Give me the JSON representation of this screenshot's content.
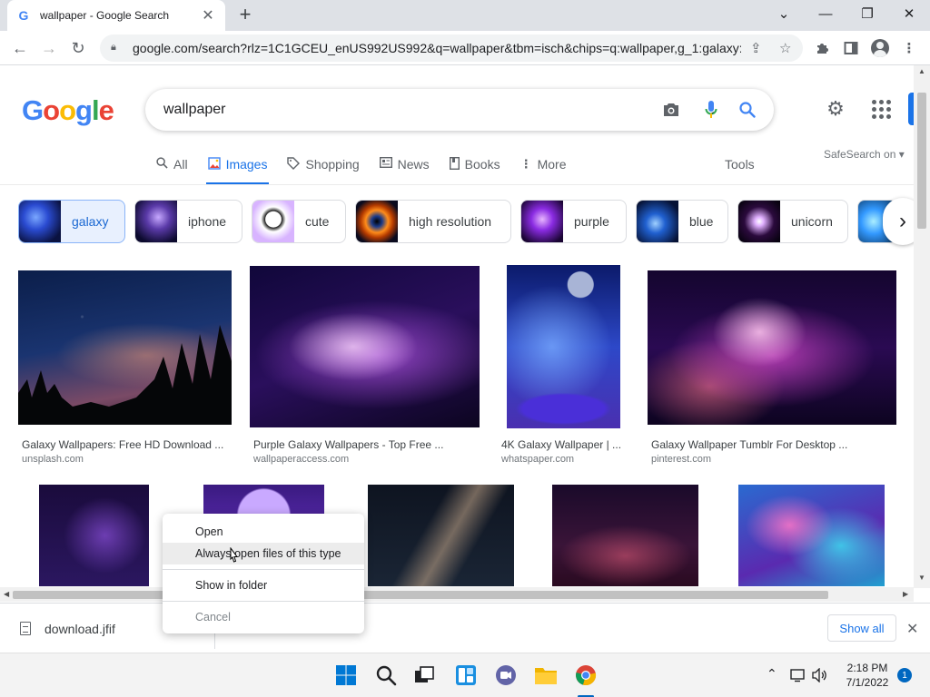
{
  "browser": {
    "tab_title": "wallpaper - Google Search",
    "url": "google.com/search?rlz=1C1GCEU_enUS992US992&q=wallpaper&tbm=isch&chips=q:wallpaper,g_1:galaxy:..."
  },
  "google": {
    "logo": "Google",
    "query": "wallpaper",
    "tabs": [
      {
        "label": "All",
        "icon": "search-icon"
      },
      {
        "label": "Images",
        "icon": "images-icon",
        "active": true
      },
      {
        "label": "Shopping",
        "icon": "tag-icon"
      },
      {
        "label": "News",
        "icon": "news-icon"
      },
      {
        "label": "Books",
        "icon": "book-icon"
      },
      {
        "label": "More",
        "icon": "more-vert-icon"
      }
    ],
    "tools_label": "Tools",
    "safesearch_label": "SafeSearch on"
  },
  "chips": [
    {
      "label": "galaxy",
      "selected": true
    },
    {
      "label": "iphone"
    },
    {
      "label": "cute"
    },
    {
      "label": "high resolution"
    },
    {
      "label": "purple"
    },
    {
      "label": "blue"
    },
    {
      "label": "unicorn"
    }
  ],
  "results": [
    {
      "title": "Galaxy Wallpapers: Free HD Download ...",
      "source": "unsplash.com"
    },
    {
      "title": "Purple Galaxy Wallpapers - Top Free ...",
      "source": "wallpaperaccess.com"
    },
    {
      "title": "4K Galaxy Wallpaper | ...",
      "source": "whatspaper.com"
    },
    {
      "title": "Galaxy Wallpaper Tumblr For Desktop ...",
      "source": "pinterest.com"
    }
  ],
  "download": {
    "filename": "download.jfif",
    "show_all_label": "Show all"
  },
  "context_menu": {
    "items": [
      "Open",
      "Always open files of this type",
      "Show in folder",
      "Cancel"
    ]
  },
  "taskbar": {
    "time": "2:18 PM",
    "date": "7/1/2022",
    "notification_count": "1"
  },
  "colors": {
    "google_blue": "#4285f4",
    "google_red": "#ea4335",
    "google_yellow": "#fbbc05",
    "google_green": "#34a853",
    "link_blue": "#1a73e8"
  }
}
